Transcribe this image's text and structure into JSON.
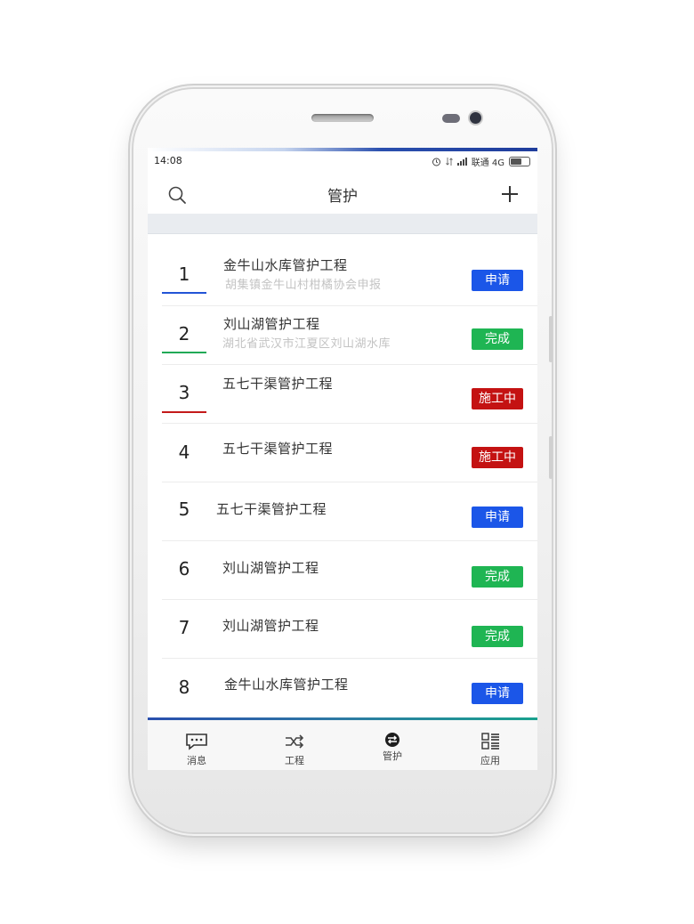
{
  "status_bar": {
    "time": "14:08",
    "carrier": "联通 4G"
  },
  "header": {
    "title": "管护"
  },
  "items": [
    {
      "number": "1",
      "title": "金牛山水库管护工程",
      "subtitle": "胡集镇金牛山村柑橘协会申报",
      "status": "申请",
      "status_color": "#1b56e8",
      "underline_color": "#2254d6"
    },
    {
      "number": "2",
      "title": "刘山湖管护工程",
      "subtitle": "湖北省武汉市江夏区刘山湖水库",
      "status": "完成",
      "status_color": "#1fb553",
      "underline_color": "#21a956"
    },
    {
      "number": "3",
      "title": "五七干渠管护工程",
      "subtitle": "",
      "status": "施工中",
      "status_color": "#c41212",
      "underline_color": "#c41a1a"
    },
    {
      "number": "4",
      "title": "五七干渠管护工程",
      "subtitle": "",
      "status": "施工中",
      "status_color": "#c41212",
      "underline_color": ""
    },
    {
      "number": "5",
      "title": "五七干渠管护工程",
      "subtitle": "",
      "status": "申请",
      "status_color": "#1b56e8",
      "underline_color": ""
    },
    {
      "number": "6",
      "title": "刘山湖管护工程",
      "subtitle": "",
      "status": "完成",
      "status_color": "#1fb553",
      "underline_color": ""
    },
    {
      "number": "7",
      "title": "刘山湖管护工程",
      "subtitle": "",
      "status": "完成",
      "status_color": "#1fb553",
      "underline_color": ""
    },
    {
      "number": "8",
      "title": "金牛山水库管护工程",
      "subtitle": "",
      "status": "申请",
      "status_color": "#1b56e8",
      "underline_color": ""
    }
  ],
  "tabs": [
    {
      "label": "消息",
      "icon": "message-icon"
    },
    {
      "label": "工程",
      "icon": "shuffle-icon"
    },
    {
      "label": "管护",
      "icon": "swap-icon"
    },
    {
      "label": "应用",
      "icon": "apps-grid-icon"
    }
  ]
}
